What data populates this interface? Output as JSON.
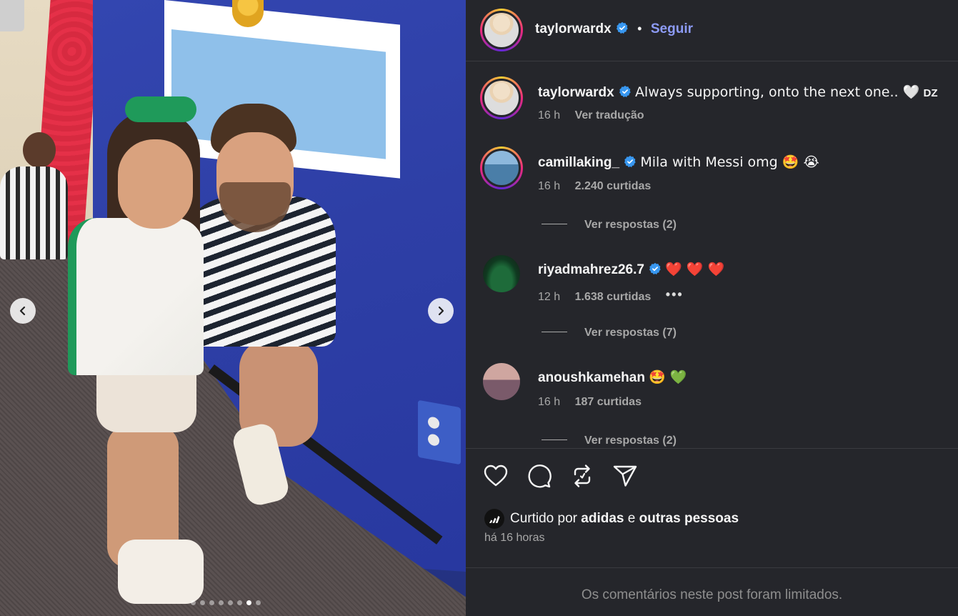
{
  "post_author": {
    "username": "taylorwardx",
    "separator": "•",
    "follow_label": "Seguir"
  },
  "caption": {
    "username": "taylorwardx",
    "text": "Always supporting, onto the next one.. 🤍",
    "suffix": "DZ",
    "time": "16 h",
    "translate_label": "Ver tradução"
  },
  "comments": [
    {
      "username": "camillaking_",
      "text": "Mila with Messi omg 🤩 😭",
      "time": "16 h",
      "likes": "2.240 curtidas",
      "replies": "Ver respostas (2)"
    },
    {
      "username": "riyadmahrez26.7",
      "text": "❤️ ❤️ ❤️",
      "time": "12 h",
      "likes": "1.638 curtidas",
      "more": "•••",
      "replies": "Ver respostas (7)"
    },
    {
      "username": "anoushkamehan",
      "text": "🤩 💚",
      "time": "16 h",
      "likes": "187 curtidas",
      "replies": "Ver respostas (2)"
    }
  ],
  "actions": {
    "like_icon": "heart-icon",
    "comment_icon": "comment-icon",
    "repost_icon": "repost-icon",
    "share_icon": "send-icon"
  },
  "likes": {
    "prefix": "Curtido por",
    "first_liker": "adidas",
    "connector": "e",
    "others": "outras pessoas"
  },
  "posted_ago": "há 16 horas",
  "comments_limited": "Os comentários neste post foram limitados.",
  "carousel": {
    "total": 8,
    "active_index": 6
  },
  "colors": {
    "panel_bg": "#25262b",
    "follow_link": "#8d9bf6",
    "verified_badge": "#3897f0"
  }
}
